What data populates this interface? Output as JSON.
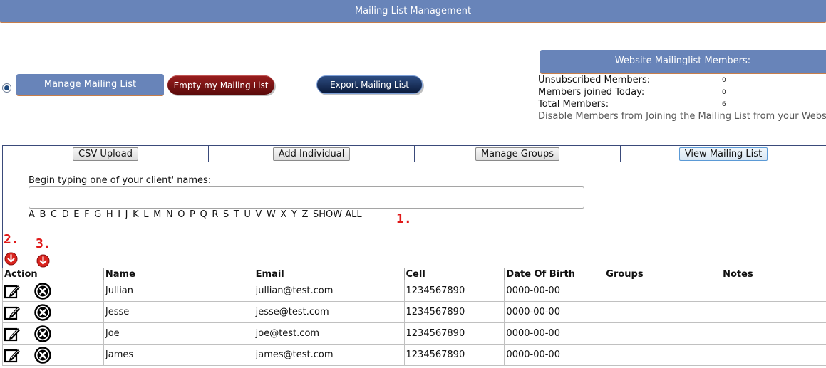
{
  "header": {
    "title": "Mailing List Management"
  },
  "controls": {
    "manage_label": "Manage Mailing List",
    "empty_label": "Empty my Mailing List",
    "export_label": "Export Mailing List"
  },
  "members": {
    "title": "Website Mailinglist Members:",
    "stats": [
      {
        "label": "Unsubscribed Members:",
        "value": "0"
      },
      {
        "label": "Members joined Today:",
        "value": "0"
      },
      {
        "label": "Total Members:",
        "value": "6"
      }
    ],
    "disable_text": "Disable Members from Joining the Mailing List from your Website"
  },
  "tabs": [
    "CSV Upload",
    "Add Individual",
    "Manage Groups",
    "View Mailing List"
  ],
  "search": {
    "label": "Begin typing one of your client' names:",
    "value": ""
  },
  "alphabet": [
    "A",
    "B",
    "C",
    "D",
    "E",
    "F",
    "G",
    "H",
    "I",
    "J",
    "K",
    "L",
    "M",
    "N",
    "O",
    "P",
    "Q",
    "R",
    "S",
    "T",
    "U",
    "V",
    "W",
    "X",
    "Y",
    "Z",
    "SHOW ALL"
  ],
  "markers": {
    "m1": "1.",
    "m2": "2.",
    "m3": "3."
  },
  "table": {
    "headers": [
      "Action",
      "Name",
      "Email",
      "Cell",
      "Date Of Birth",
      "Groups",
      "Notes"
    ],
    "rows": [
      {
        "name": "Jullian",
        "email": "jullian@test.com",
        "cell": "1234567890",
        "dob": "0000-00-00",
        "groups": "",
        "notes": ""
      },
      {
        "name": "Jesse",
        "email": "jesse@test.com",
        "cell": "1234567890",
        "dob": "0000-00-00",
        "groups": "",
        "notes": ""
      },
      {
        "name": "Joe",
        "email": "joe@test.com",
        "cell": "1234567890",
        "dob": "0000-00-00",
        "groups": "",
        "notes": ""
      },
      {
        "name": "James",
        "email": "james@test.com",
        "cell": "1234567890",
        "dob": "0000-00-00",
        "groups": "",
        "notes": ""
      }
    ]
  },
  "icons": {
    "edit": "edit-icon",
    "delete": "delete-icon",
    "sort": "sort-down-icon"
  },
  "colors": {
    "header_bg": "#6884b9",
    "accent_line": "#c77e4a",
    "marker_red": "#e01818"
  }
}
